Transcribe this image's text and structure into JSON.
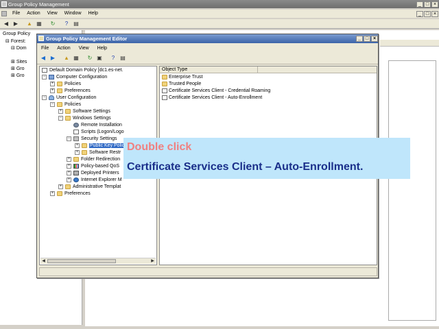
{
  "outer": {
    "title": "Group Policy Management",
    "menu": [
      "File",
      "Action",
      "View",
      "Window",
      "Help"
    ],
    "tree": [
      {
        "label": "Group Policy"
      },
      {
        "label": "Forest:"
      },
      {
        "label": "Dom"
      },
      {
        "label": "Sites"
      },
      {
        "label": "Gro"
      },
      {
        "label": "Gro"
      }
    ]
  },
  "editor": {
    "title": "Group Policy Management Editor",
    "menu": [
      "File",
      "Action",
      "View",
      "Help"
    ],
    "tree": {
      "root": "Default Domain Policy [dc1.es-net.",
      "computer_config": "Computer Configuration",
      "cc_policies": "Policies",
      "cc_preferences": "Preferences",
      "user_config": "User Configuration",
      "uc_policies": "Policies",
      "software_settings": "Software Settings",
      "windows_settings": "Windows Settings",
      "remote_installation": "Remote Installation",
      "scripts": "Scripts (Logon/Logo",
      "security_settings": "Security Settings",
      "public_key": "Public Key Polic",
      "software_restriction": "Software Restr",
      "folder_redirection": "Folder Redirection",
      "policy_qos": "Policy-based QoS",
      "deployed_printers": "Deployed Printers",
      "ie_maintenance": "Internet Explorer M",
      "admin_templates": "Administrative Templat",
      "uc_preferences": "Preferences"
    },
    "list": {
      "column": "Object Type",
      "items": [
        "Enterprise Trust",
        "Trusted People",
        "Certificate Services Client - Credential Roaming",
        "Certificate Services Client - Auto-Enrollment"
      ]
    }
  },
  "callout": {
    "line1": "Double click",
    "line2": "Certificate Services Client – Auto-Enrollment."
  },
  "colors": {
    "callout_bg": "#bfe6fb",
    "callout_line1": "#f08080",
    "callout_line2": "#1a2f8a",
    "selection": "#316ac5"
  }
}
